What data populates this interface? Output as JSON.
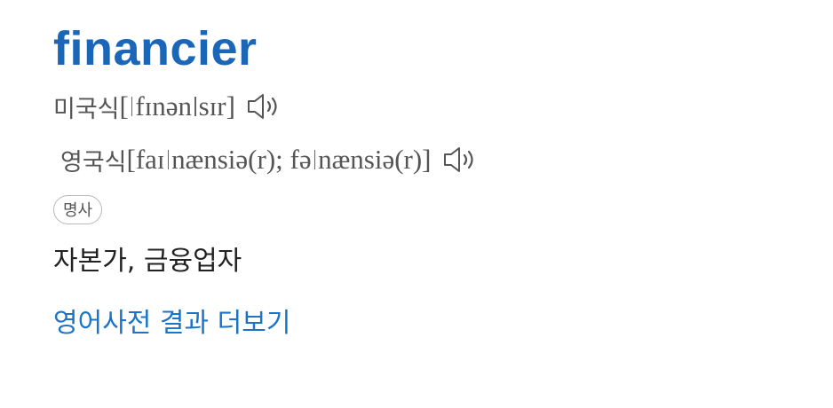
{
  "entry": {
    "headword": "financier",
    "us": {
      "label": "미국식",
      "ipa_open": "[",
      "ipa_part1": "fɪnən",
      "ipa_part2": "sɪr]",
      "speaker_icon": "speaker-icon"
    },
    "uk": {
      "label": "영국식",
      "ipa_part1": "[faɪ",
      "ipa_part2": "nænsiə(r); fə",
      "ipa_part3": "nænsiə(r)]",
      "speaker_icon": "speaker-icon"
    },
    "part_of_speech": "명사",
    "meaning": "자본가, 금융업자",
    "more_link": "영어사전 결과 더보기"
  },
  "colors": {
    "headword": "#1b66b6",
    "link": "#1b74c8",
    "text": "#222222",
    "muted": "#555555"
  }
}
